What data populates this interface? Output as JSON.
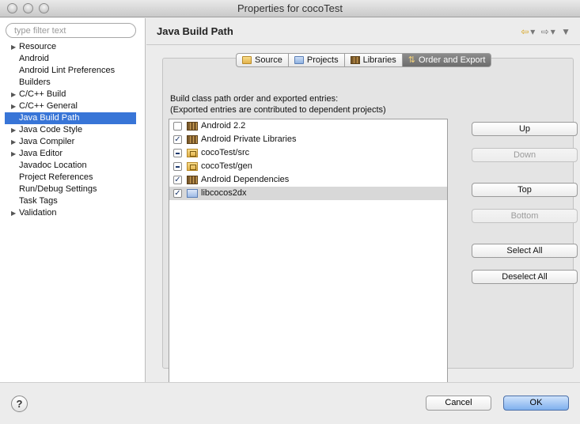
{
  "window": {
    "title": "Properties for cocoTest"
  },
  "filter": {
    "placeholder": "type filter text"
  },
  "tree": [
    {
      "label": "Resource",
      "expandable": true
    },
    {
      "label": "Android",
      "expandable": false
    },
    {
      "label": "Android Lint Preferences",
      "expandable": false
    },
    {
      "label": "Builders",
      "expandable": false
    },
    {
      "label": "C/C++ Build",
      "expandable": true
    },
    {
      "label": "C/C++ General",
      "expandable": true
    },
    {
      "label": "Java Build Path",
      "expandable": false,
      "selected": true
    },
    {
      "label": "Java Code Style",
      "expandable": true
    },
    {
      "label": "Java Compiler",
      "expandable": true
    },
    {
      "label": "Java Editor",
      "expandable": true
    },
    {
      "label": "Javadoc Location",
      "expandable": false
    },
    {
      "label": "Project References",
      "expandable": false
    },
    {
      "label": "Run/Debug Settings",
      "expandable": false
    },
    {
      "label": "Task Tags",
      "expandable": false
    },
    {
      "label": "Validation",
      "expandable": true
    }
  ],
  "page": {
    "title": "Java Build Path"
  },
  "tabs": [
    {
      "label": "Source",
      "icon": "folder-icon"
    },
    {
      "label": "Projects",
      "icon": "project-icon"
    },
    {
      "label": "Libraries",
      "icon": "library-icon"
    },
    {
      "label": "Order and Export",
      "icon": "order-icon",
      "active": true
    }
  ],
  "order": {
    "description_line1": "Build class path order and exported entries:",
    "description_line2": "(Exported entries are contributed to dependent projects)",
    "entries": [
      {
        "label": "Android 2.2",
        "state": "unchecked",
        "icon": "library"
      },
      {
        "label": "Android Private Libraries",
        "state": "checked",
        "icon": "library"
      },
      {
        "label": "cocoTest/src",
        "state": "partial",
        "icon": "source-folder"
      },
      {
        "label": "cocoTest/gen",
        "state": "partial",
        "icon": "source-folder"
      },
      {
        "label": "Android Dependencies",
        "state": "checked",
        "icon": "library"
      },
      {
        "label": "libcocos2dx",
        "state": "checked",
        "icon": "project-folder",
        "selected": true
      }
    ]
  },
  "buttons": {
    "up": "Up",
    "down": "Down",
    "top": "Top",
    "bottom": "Bottom",
    "select_all": "Select All",
    "deselect_all": "Deselect All"
  },
  "footer": {
    "help": "?",
    "cancel": "Cancel",
    "ok": "OK"
  }
}
